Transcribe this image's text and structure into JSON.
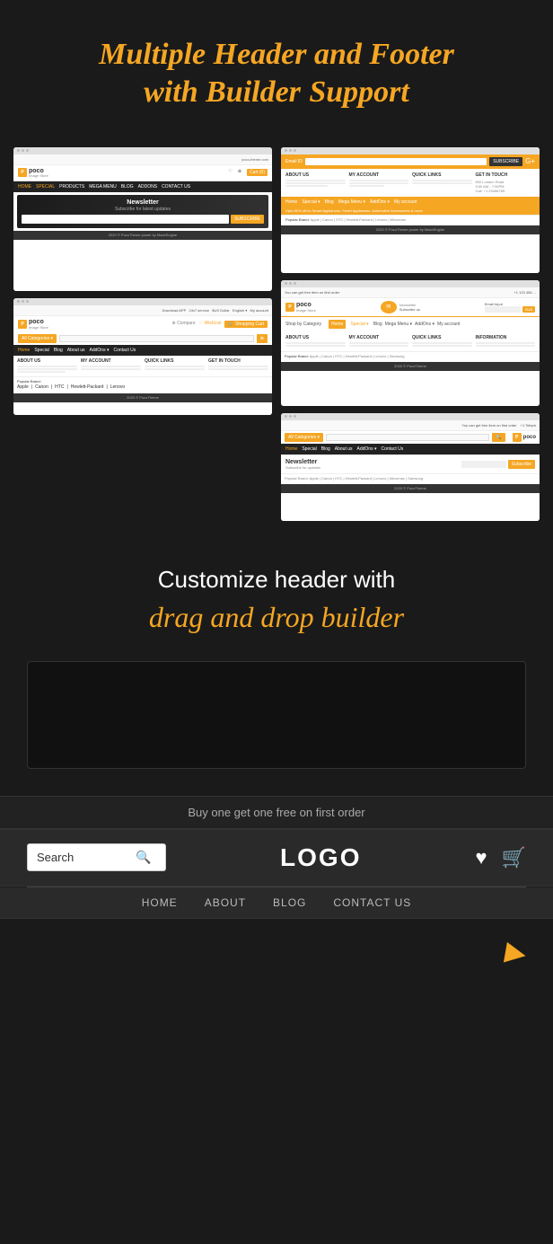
{
  "hero": {
    "title_line1": "Multiple Header and Footer",
    "title_line2": "with Builder",
    "title_accent": "Support"
  },
  "customize": {
    "title": "Customize header with",
    "subtitle": "drag and drop builder"
  },
  "promo": {
    "text": "Buy one get one free on first order"
  },
  "demo_header": {
    "search_placeholder": "Search",
    "logo": "LOGO",
    "search_icon": "🔍",
    "wishlist_icon": "♥",
    "cart_icon": "🛒"
  },
  "demo_nav": {
    "items": [
      {
        "label": "HOME"
      },
      {
        "label": "ABOUT"
      },
      {
        "label": "BLOG"
      },
      {
        "label": "CONTACT US"
      }
    ]
  },
  "screenshots": {
    "s1": {
      "logo": "poco",
      "tagline": "Image Store",
      "nav": [
        "HOME",
        "SPECIAL",
        "PRODUCTS",
        "MEGA MENU",
        "BLOG",
        "ADDONS",
        "CONTACT US"
      ],
      "section": "Newsletter",
      "footer_text": "2020 © PocoTheme power by MazeEngine"
    },
    "s2": {
      "nav": [
        "Home",
        "Special",
        "Blog",
        "About us",
        "AddOns",
        "Contact Us"
      ],
      "logo": "poco",
      "tagline": "Image Store"
    },
    "s3": {
      "logo": "poco",
      "tagline": "Image Store",
      "email_placeholder": "Email ID",
      "subscribe_btn": "SUBSCRIBE"
    },
    "s4": {
      "logo": "poco",
      "tagline": "Image Store",
      "newsletter_title": "Newsletter",
      "categories_btn": "All Categories",
      "search_btn": "SEARCH"
    },
    "s5": {
      "logo": "poco",
      "tagline": "Image Store",
      "newsletter_title": "Newsletter",
      "subscribe_btn": "Subscribe"
    }
  },
  "cursor": {
    "icon": "▶"
  }
}
